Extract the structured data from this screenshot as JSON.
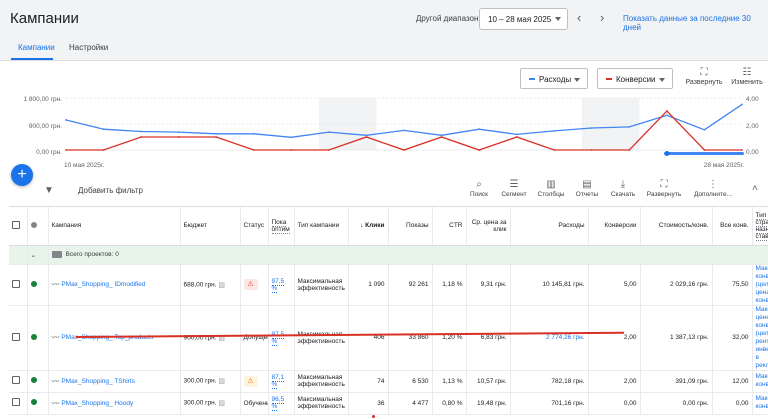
{
  "header": {
    "title": "Кампании",
    "range_label": "Другой диапазон",
    "date_range": "10 – 28 мая 2025",
    "last30_link": "Показать данные за последние 30 дней"
  },
  "tabs": [
    {
      "label": "Кампании",
      "active": true
    },
    {
      "label": "Настройки",
      "active": false
    }
  ],
  "chart_controls": {
    "metric1": {
      "label": "Расходы",
      "color": "#4285f4"
    },
    "metric2": {
      "label": "Конверсии",
      "color": "#d93025"
    },
    "expand_label": "Развернуть",
    "edit_label": "Изменить"
  },
  "chart_data": {
    "type": "line",
    "y_left_ticks": [
      "1 800,00 грн.",
      "900,00 грн.",
      "0,00 грн."
    ],
    "y_right_ticks": [
      "4,00",
      "2,00",
      "0,00"
    ],
    "ylim_left": [
      0,
      1800
    ],
    "ylim_right": [
      0,
      4
    ],
    "x_start_label": "10 мая 2025г.",
    "x_end_label": "28 мая 2025г.",
    "series": [
      {
        "name": "Расходы",
        "color": "#4285f4",
        "values": [
          1040,
          720,
          640,
          620,
          560,
          560,
          440,
          620,
          510,
          680,
          510,
          720,
          540,
          660,
          760,
          800,
          1200,
          700,
          1580
        ]
      },
      {
        "name": "Конверсии",
        "color": "#d93025",
        "values": [
          0,
          0,
          1,
          1,
          1,
          0,
          0,
          0,
          1,
          0,
          1,
          0,
          1,
          0,
          0,
          0,
          3,
          0,
          0
        ]
      }
    ],
    "grid": true
  },
  "fab_label": "+",
  "toolbar": {
    "add_filter": "Добавить фильтр",
    "tools": [
      {
        "label": "Поиск",
        "icon": "search-icon",
        "glyph": "⌕"
      },
      {
        "label": "Сегмент",
        "icon": "segment-icon",
        "glyph": "☰"
      },
      {
        "label": "Столбцы",
        "icon": "columns-icon",
        "glyph": "▥"
      },
      {
        "label": "Отчеты",
        "icon": "reports-icon",
        "glyph": "▤"
      },
      {
        "label": "Скачать",
        "icon": "download-icon",
        "glyph": "⤓"
      },
      {
        "label": "Развернуть",
        "icon": "fullscreen-icon",
        "glyph": "⛶"
      },
      {
        "label": "Дополните...",
        "icon": "more-icon",
        "glyph": "⋮"
      }
    ]
  },
  "table": {
    "headers": {
      "campaign": "Кампания",
      "budget": "Бюджет",
      "status": "Статус",
      "opt_score": "Пока оптим",
      "type": "Тип кампании",
      "clicks": "Клики",
      "impressions": "Показы",
      "ctr": "CTR",
      "avg_cpc": "Ср. цена за клик",
      "cost": "Расходы",
      "conversions": "Конверсии",
      "cost_per_conv": "Стоимость/конв.",
      "all_conv": "Все конв.",
      "bid_strategy": "Тип стратегии назначения ставок"
    },
    "total_label": "Всего проектов: 0",
    "rows": [
      {
        "campaign": "PMax_Shopping_ IDmodified",
        "budget": "688,00 грн.",
        "status": "",
        "opt": "97,5 %",
        "type": "Максимальная эффективность",
        "clicks": "1 090",
        "impressions": "92 261",
        "ctr": "1,18 %",
        "cpc": "9,31 грн.",
        "cost": "10 145,81 грн.",
        "conversions": "5,00",
        "cost_per_conv": "2 029,16 грн.",
        "all_conv": "75,50",
        "strategy": "Максимум конверсий (целевая цена за конверсию)"
      },
      {
        "campaign": "PMax_Shopping_ Top_products",
        "budget": "900,00 грн.",
        "status": "Допущен",
        "opt": "97,5 %",
        "type": "Максимальная эффективность",
        "clicks": "406",
        "impressions": "33 860",
        "ctr": "1,20 %",
        "cpc": "6,83 грн.",
        "cost": "2 774,26 грн.",
        "conversions": "2,00",
        "cost_per_conv": "1 387,13 грн.",
        "all_conv": "32,00",
        "strategy": "Максимальная ценность конверсий (целевая рентабельность инвестиций в рекламу)"
      },
      {
        "campaign": "PMax_Shopping_ TShirts",
        "budget": "300,00 грн.",
        "status": "",
        "opt": "87,1 %",
        "type": "Максимальная эффективность",
        "clicks": "74",
        "impressions": "6 530",
        "ctr": "1,13 %",
        "cpc": "10,57 грн.",
        "cost": "782,18 грн.",
        "conversions": "2,00",
        "cost_per_conv": "391,09 грн.",
        "all_conv": "12,00",
        "strategy": "Максимум конверсий"
      },
      {
        "campaign": "PMax_Shopping_ Hoody",
        "budget": "300,00 грн.",
        "status": "Обучение",
        "opt": "96,5 %",
        "type": "Максимальная эффективность",
        "clicks": "36",
        "impressions": "4 477",
        "ctr": "0,80 %",
        "cpc": "19,48 грн.",
        "cost": "701,16 грн.",
        "conversions": "0,00",
        "cost_per_conv": "0,00 грн.",
        "all_conv": "0,00",
        "strategy": "Максимум конверсий"
      }
    ]
  }
}
